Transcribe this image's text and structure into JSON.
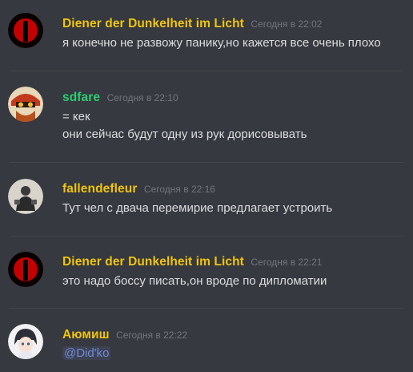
{
  "colors": {
    "background": "#36393f",
    "divider": "#42454a",
    "timestamp": "#72767d",
    "text": "#dcddde",
    "mention_fg": "#7289da"
  },
  "messages": [
    {
      "author": "Diener der Dunkelheit im Licht",
      "author_color": "#f1c40f",
      "avatar": "red-moon-silhouette-avatar",
      "timestamp": "Сегодня в 22:02",
      "lines": [
        "я конечно не развожу панику,но кажется все очень плохо"
      ]
    },
    {
      "author": "sdfare",
      "author_color": "#2ecc71",
      "avatar": "anime-character-avatar",
      "timestamp": "Сегодня в 22:10",
      "lines": [
        "= кек",
        "они сейчас будут одну из рук дорисовывать"
      ]
    },
    {
      "author": "fallendefleur",
      "author_color": "#f1c40f",
      "avatar": "dark-figure-avatar",
      "timestamp": "Сегодня в 22:16",
      "lines": [
        "Тут чел с  двача перемирие предлагает устроить"
      ]
    },
    {
      "author": "Diener der Dunkelheit im Licht",
      "author_color": "#f1c40f",
      "avatar": "red-moon-silhouette-avatar",
      "timestamp": "Сегодня в 22:21",
      "lines": [
        "это надо боссу писать,он вроде по дипломатии"
      ]
    },
    {
      "author": "Аюмиш",
      "author_color": "#f1c40f",
      "avatar": "anime-girl-avatar",
      "timestamp": "Сегодня в 22:22",
      "mention": "@Did'ko"
    }
  ]
}
